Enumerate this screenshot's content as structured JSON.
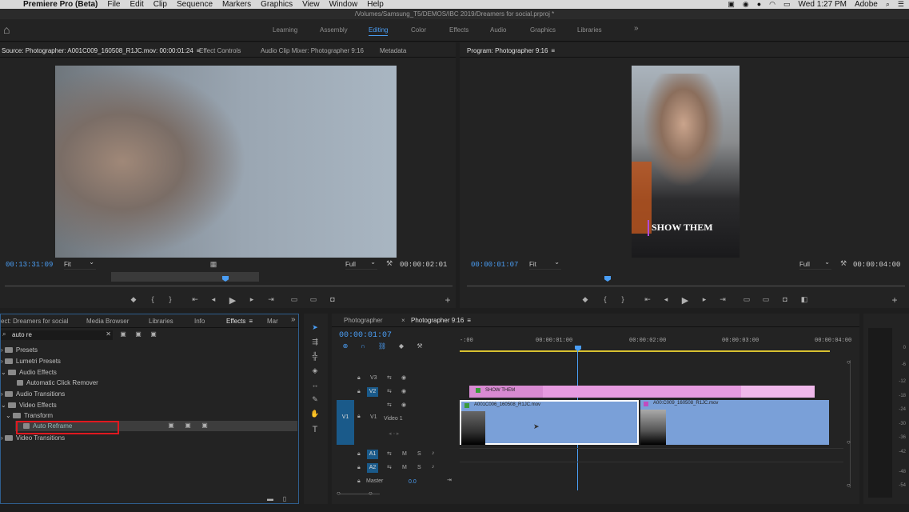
{
  "menubar": {
    "app": "Premiere Pro (Beta)",
    "items": [
      "File",
      "Edit",
      "Clip",
      "Sequence",
      "Markers",
      "Graphics",
      "View",
      "Window",
      "Help"
    ],
    "clock": "Wed 1:27 PM",
    "user": "Adobe"
  },
  "path": "/Volumes/Samsung_T5/DEMOS/IBC 2019/Dreamers for social.prproj *",
  "workspaces": [
    "Learning",
    "Assembly",
    "Editing",
    "Color",
    "Effects",
    "Audio",
    "Graphics",
    "Libraries"
  ],
  "active_workspace": "Editing",
  "source": {
    "tabs": [
      "Source: Photographer: A001C009_160508_R1JC.mov: 00:00:01:24",
      "Effect Controls",
      "Audio Clip Mixer: Photographer 9:16",
      "Metadata"
    ],
    "timecode": "00:13:31:09",
    "fit": "Fit",
    "quality": "Full",
    "duration": "00:00:02:01"
  },
  "program": {
    "tab": "Program: Photographer 9:16",
    "timecode": "00:00:01:07",
    "fit": "Fit",
    "quality": "Full",
    "duration": "00:00:04:00",
    "caption": "SHOW THEM"
  },
  "effects_panel": {
    "tabs": [
      "ect: Dreamers for social",
      "Media Browser",
      "Libraries",
      "Info",
      "Effects",
      "Mar"
    ],
    "search": "auto re",
    "tree": [
      "Presets",
      "Lumetri Presets",
      "Audio Effects",
      "Automatic Click Remover",
      "Audio Transitions",
      "Video Effects",
      "Transform",
      "Auto Reframe",
      "Video Transitions"
    ],
    "highlighted": "Auto Reframe"
  },
  "timeline": {
    "tabs": [
      "Photographer",
      "Photographer 9:16"
    ],
    "timecode": "00:00:01:07",
    "ruler": [
      "-:00",
      "00:00:01:00",
      "00:00:02:00",
      "00:00:03:00",
      "00:00:04:00"
    ],
    "tracks": {
      "v3": "V3",
      "v2": "V2",
      "v1": "V1",
      "v1name": "Video 1",
      "a1": "A1",
      "a2": "A2",
      "master": "Master",
      "master_val": "0.0"
    },
    "clips": {
      "title": "SHOW THEM",
      "clip1": "A001C006_160508_R1JC.mov",
      "clip2": "A00:C009_160508_R1JC.mov"
    },
    "buttons": {
      "m": "M",
      "s": "S"
    }
  },
  "meter": [
    "0",
    "-6",
    "-12",
    "-18",
    "-24",
    "-30",
    "-36",
    "-42",
    "-48",
    "-54"
  ],
  "colors": {
    "accent": "#4a9ef5",
    "highlight_box": "#e0181f",
    "title_clip": "#e69be0",
    "video_clip": "#7aa0d8"
  }
}
